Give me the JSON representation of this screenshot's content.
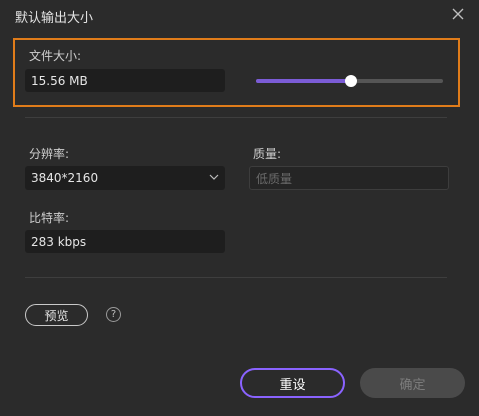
{
  "dialog": {
    "title": "默认输出大小",
    "close_icon": "close-icon"
  },
  "file_size": {
    "label": "文件大小:",
    "value": "15.56 MB",
    "slider_level": 0.51,
    "accent_color": "#7b5cd6",
    "highlight_color": "#e07c1a"
  },
  "resolution": {
    "label": "分辨率:",
    "selected": "3840*2160",
    "chevron_icon": "chevron-down-icon"
  },
  "quality": {
    "label": "质量:",
    "placeholder": "低质量"
  },
  "bitrate": {
    "label": "比特率:",
    "value": "283 kbps"
  },
  "preview": {
    "label": "预览",
    "help_icon": "question-mark-icon",
    "help_glyph": "?"
  },
  "footer": {
    "reset_label": "重设",
    "confirm_label": "确定"
  }
}
